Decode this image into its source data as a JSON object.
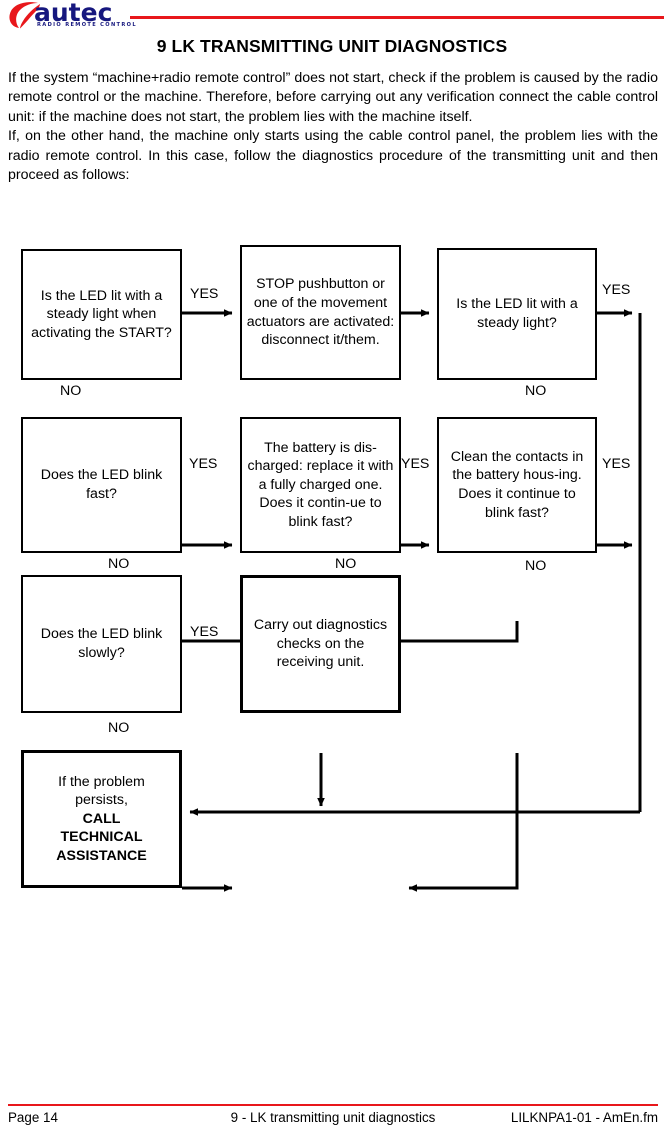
{
  "header": {
    "logo_wordmark": "autec",
    "logo_tagline": "RADIO REMOTE CONTROL",
    "accent_color": "#e8171b",
    "logo_color": "#16177e"
  },
  "title": "9  LK TRANSMITTING UNIT DIAGNOSTICS",
  "intro": {
    "paragraph_1": "If the system “machine+radio remote control” does not start, check if the problem is caused by the radio remote control or the machine. Therefore, before carrying out any verification connect the cable control unit: if the machine does not start, the problem lies with the machine itself.",
    "paragraph_2": "If, on the other hand, the machine only starts using the cable control panel, the problem lies with the radio remote control. In this case, follow the diagnostics procedure of the transmitting unit and then proceed as follows:"
  },
  "flowchart": {
    "boxes": {
      "q1": "Is the LED lit with a steady light when activating the START?",
      "a1": "STOP pushbutton or one of the movement actuators are activated: disconnect it/them.",
      "q2": "Is the LED lit with a steady light?",
      "q3": "Does the LED blink fast?",
      "a2": "The battery is dis-charged: replace it with a fully charged one. Does it contin-ue to blink fast?",
      "a3": "Clean the contacts in the battery hous-ing. Does it continue to blink fast?",
      "q4": "Does the LED blink slowly?",
      "a4": "Carry out diagnostics checks on the receiving unit.",
      "end_line1": "If the problem",
      "end_line2": "persists,",
      "end_line3": "CALL",
      "end_line4": "TECHNICAL",
      "end_line5": "ASSISTANCE"
    },
    "labels": {
      "yes_q1": "YES",
      "no_q1": "NO",
      "yes_q2": "YES",
      "no_q2": "NO",
      "yes_q3": "YES",
      "no_q3": "NO",
      "yes_a2": "YES",
      "no_a2": "NO",
      "yes_a3": "YES",
      "no_a3": "NO",
      "yes_q4": "YES",
      "no_q4": "NO"
    }
  },
  "footer": {
    "left": "Page 14",
    "center": "9 - LK transmitting unit diagnostics",
    "right": "LILKNPA1-01 - AmEn.fm"
  }
}
